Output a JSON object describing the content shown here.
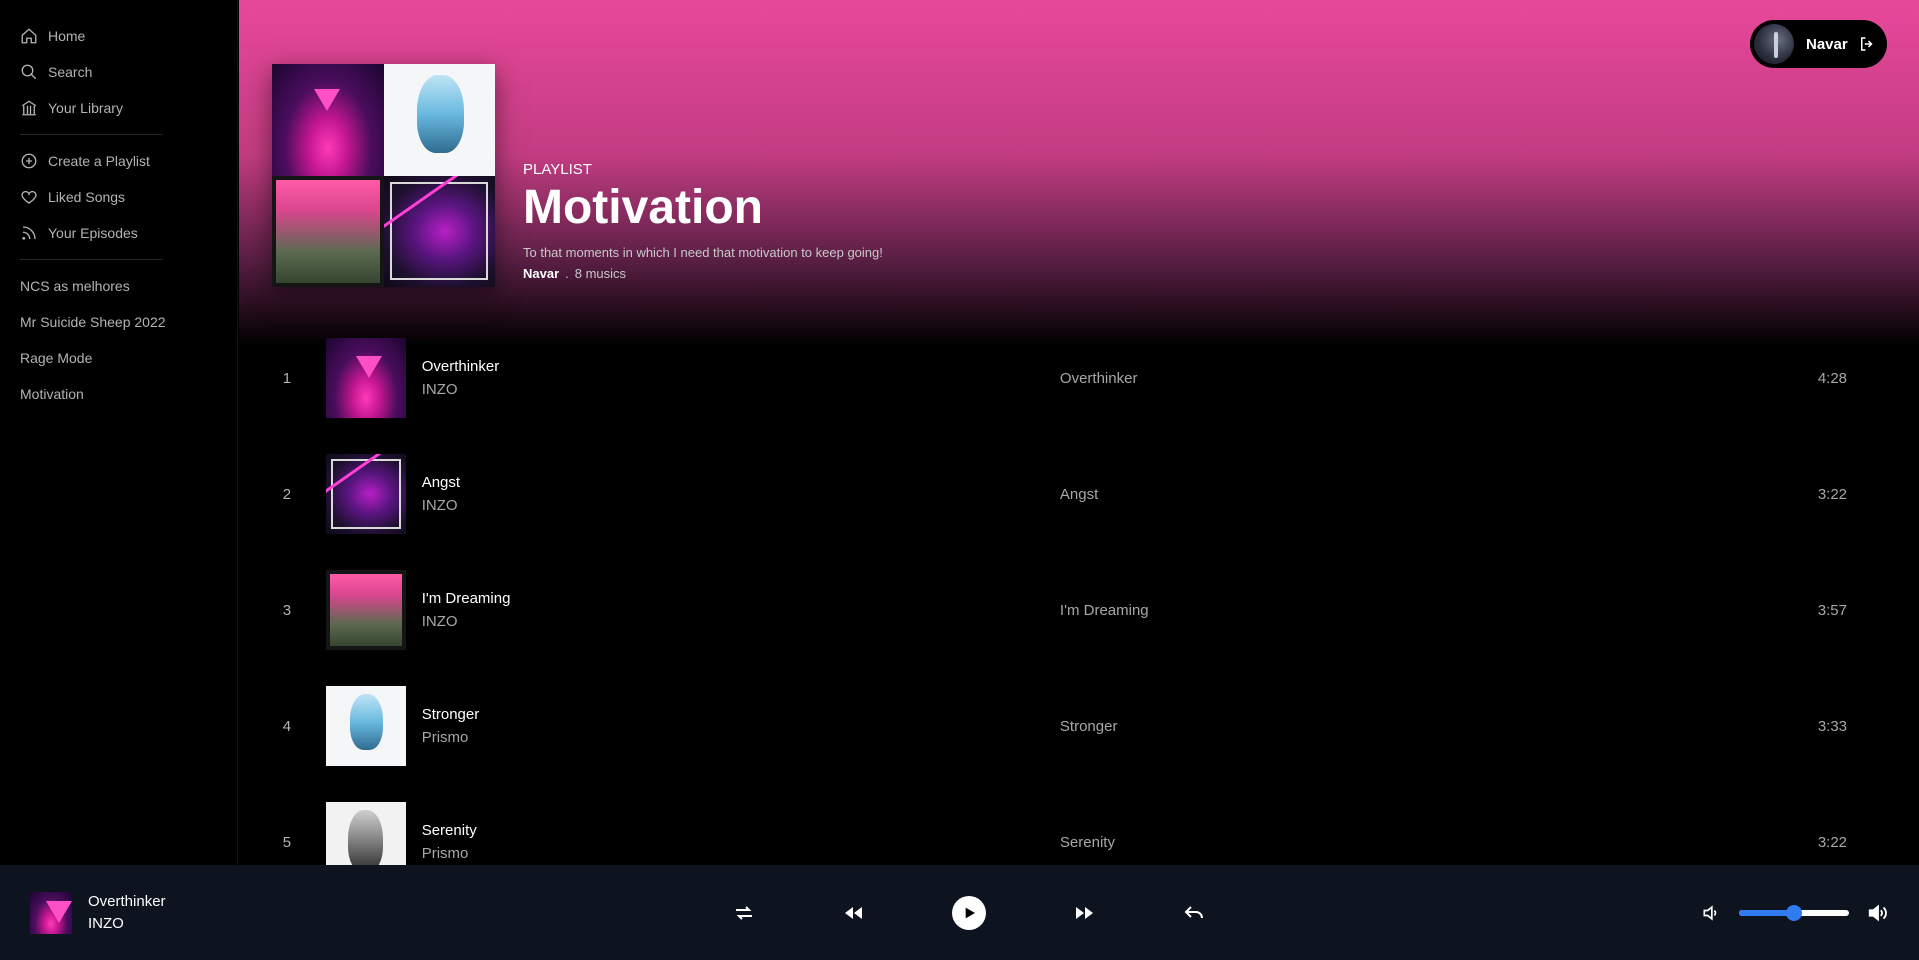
{
  "sidebar": {
    "nav": [
      {
        "label": "Home",
        "icon": "home-icon"
      },
      {
        "label": "Search",
        "icon": "search-icon"
      },
      {
        "label": "Your Library",
        "icon": "library-icon"
      }
    ],
    "actions": [
      {
        "label": "Create a Playlist",
        "icon": "plus-circle-icon"
      },
      {
        "label": "Liked Songs",
        "icon": "heart-icon"
      },
      {
        "label": "Your Episodes",
        "icon": "rss-icon"
      }
    ],
    "playlists": [
      "NCS as melhores",
      "Mr Suicide Sheep 2022",
      "Rage Mode",
      "Motivation"
    ]
  },
  "user": {
    "name": "Navar"
  },
  "playlist": {
    "type": "PLAYLIST",
    "title": "Motivation",
    "description": "To that moments in which I need that motivation to keep going!",
    "owner": "Navar",
    "separator": ".",
    "count": "8 musics"
  },
  "tracks": [
    {
      "num": "1",
      "title": "Overthinker",
      "artist": "INZO",
      "album": "Overthinker",
      "duration": "4:28"
    },
    {
      "num": "2",
      "title": "Angst",
      "artist": "INZO",
      "album": "Angst",
      "duration": "3:22"
    },
    {
      "num": "3",
      "title": "I'm Dreaming",
      "artist": "INZO",
      "album": "I'm Dreaming",
      "duration": "3:57"
    },
    {
      "num": "4",
      "title": "Stronger",
      "artist": "Prismo",
      "album": "Stronger",
      "duration": "3:33"
    },
    {
      "num": "5",
      "title": "Serenity",
      "artist": "Prismo",
      "album": "Serenity",
      "duration": "3:22"
    }
  ],
  "player": {
    "title": "Overthinker",
    "artist": "INZO",
    "volume": 0.5
  },
  "colors": {
    "accent_gradient_top": "#e8489a",
    "player_bg": "#0e1320",
    "volume_accent": "#2f7bef"
  }
}
